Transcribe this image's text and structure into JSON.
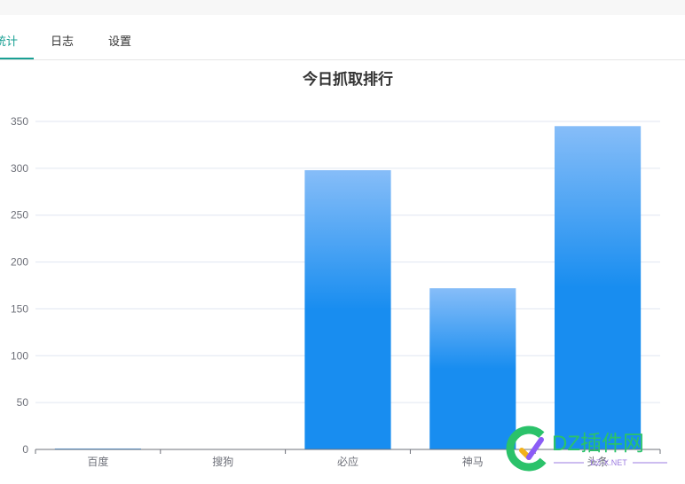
{
  "tabs": [
    {
      "label": "统计",
      "active": true
    },
    {
      "label": "日志",
      "active": false
    },
    {
      "label": "设置",
      "active": false
    }
  ],
  "chart_data": {
    "type": "bar",
    "title": "今日抓取排行",
    "categories": [
      "百度",
      "搜狗",
      "必应",
      "神马",
      "头条"
    ],
    "values": [
      1,
      0,
      298,
      172,
      345
    ],
    "ylim": [
      0,
      350
    ],
    "yticks": [
      0,
      50,
      100,
      150,
      200,
      250,
      300,
      350
    ],
    "grid": true,
    "bar_color_top": "#86bdf8",
    "bar_color_bottom": "#188df0"
  },
  "watermark": {
    "brand": "DZ插件网",
    "site": "DZ-X.NET"
  }
}
